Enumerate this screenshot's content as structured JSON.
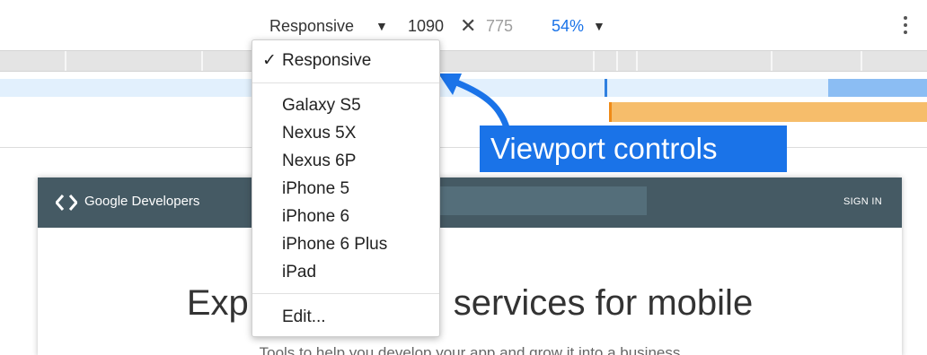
{
  "toolbar": {
    "device_label": "Responsive",
    "width_value": "1090",
    "dimension_separator": "✕",
    "height_value": "775",
    "zoom_label": "54%",
    "dropdown_arrow": "▼"
  },
  "device_menu": {
    "checkmark": "✓",
    "selected": "Responsive",
    "items": [
      "Galaxy S5",
      "Nexus 5X",
      "Nexus 6P",
      "iPhone 5",
      "iPhone 6",
      "iPhone 6 Plus",
      "iPad"
    ],
    "edit_label": "Edit..."
  },
  "callout": {
    "text": "Viewport controls"
  },
  "emulated_page": {
    "logo_text": "Google Developers",
    "sign_in": "SIGN IN",
    "hero_title_left": "Exp",
    "hero_title_right": "services for mobile",
    "hero_subtitle": "Tools to help you develop your app and grow it into a business"
  },
  "colors": {
    "accent": "#1a73e8",
    "site_header": "#455a64",
    "media_query_blue": "#8bbdf3",
    "media_query_orange": "#f6bd6b"
  },
  "icons": [
    "chevron-down-icon",
    "more-vert-icon",
    "checkmark-icon",
    "google-developers-logo-icon",
    "arrow-icon"
  ]
}
